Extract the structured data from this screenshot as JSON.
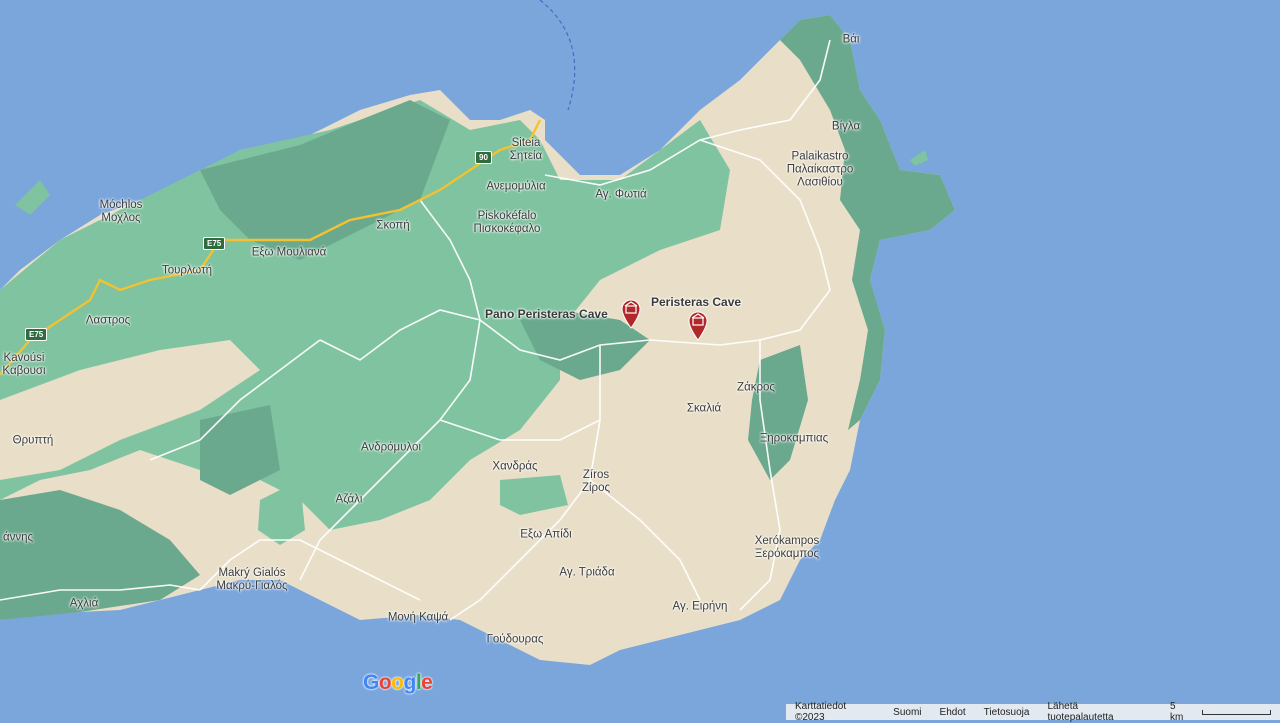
{
  "colors": {
    "sea": "#7aa6dc",
    "land": "#e9dfc8",
    "forest": "#7fc3a0",
    "forest_dark": "#6aa98e",
    "road": "#ffffff",
    "highway": "#f2c232",
    "pin": "#b0282a"
  },
  "places": [
    {
      "id": "vai",
      "text": "Βάι"
    },
    {
      "id": "vigla",
      "text": "Βίγλα"
    },
    {
      "id": "palaikastro",
      "text": "Palaikastro\nΠαλαίκαστρο\nΛασιθίου"
    },
    {
      "id": "siteia",
      "text": "Siteia\nΣητεία"
    },
    {
      "id": "anemomylia",
      "text": "Ανεμομύλια"
    },
    {
      "id": "ag_fotia",
      "text": "Αγ. Φωτιά"
    },
    {
      "id": "mochlos",
      "text": "Móchlos\nΜοχλος"
    },
    {
      "id": "piskokefalo",
      "text": "Piskokéfalo\nΠισκοκέφαλο"
    },
    {
      "id": "skopi",
      "text": "Σκοπή"
    },
    {
      "id": "exo_moulianа",
      "text": "Εξω Μουλιανά"
    },
    {
      "id": "tourloti",
      "text": "Τουρλωτή"
    },
    {
      "id": "lastros",
      "text": "Λαστρος"
    },
    {
      "id": "kavousi",
      "text": "Kavoúsi\nΚαβουσι"
    },
    {
      "id": "thrypti",
      "text": "Θρυπτή"
    },
    {
      "id": "zakros",
      "text": "Ζάκρος"
    },
    {
      "id": "skalia",
      "text": "Σκαλιά"
    },
    {
      "id": "xirokampias",
      "text": "Ξηροκαμπιας"
    },
    {
      "id": "andromyloi",
      "text": "Ανδρόμυλοι"
    },
    {
      "id": "azali",
      "text": "Αζάλι"
    },
    {
      "id": "chandras",
      "text": "Χανδράς"
    },
    {
      "id": "ziros",
      "text": "Zíros\nΖίρος"
    },
    {
      "id": "exo_apidi",
      "text": "Εξω Απίδι"
    },
    {
      "id": "ag_triada",
      "text": "Αγ. Τριάδα"
    },
    {
      "id": "xerokampos",
      "text": "Xerókampos\nΞερόκαμπος"
    },
    {
      "id": "ag_eirini",
      "text": "Αγ. Ειρήνη"
    },
    {
      "id": "makry_gialos",
      "text": "Makrý Gialós\nΜακρύ-Γιαλός"
    },
    {
      "id": "moni_kapsa",
      "text": "Μονή Καψά"
    },
    {
      "id": "goudouras",
      "text": "Γούδουρας"
    },
    {
      "id": "achlia",
      "text": "Αχλιά"
    },
    {
      "id": "anis",
      "text": "άννης"
    }
  ],
  "pois": [
    {
      "id": "pano_peristeras",
      "text": "Pano Peristeras Cave",
      "icon": "museum-pin-icon"
    },
    {
      "id": "peristeras",
      "text": "Peristeras Cave",
      "icon": "museum-pin-icon"
    }
  ],
  "road_shields": {
    "route_90": "90",
    "e75_a": "E75",
    "e75_b": "E75"
  },
  "logo": {
    "g": "G",
    "o1": "o",
    "o2": "o",
    "g2": "g",
    "l": "l",
    "e": "e"
  },
  "footer": {
    "map_data": "Karttatiedot ©2023",
    "country": "Suomi",
    "terms": "Ehdot",
    "privacy": "Tietosuoja",
    "feedback": "Lähetä tuotepalautetta",
    "scale": "5 km"
  }
}
